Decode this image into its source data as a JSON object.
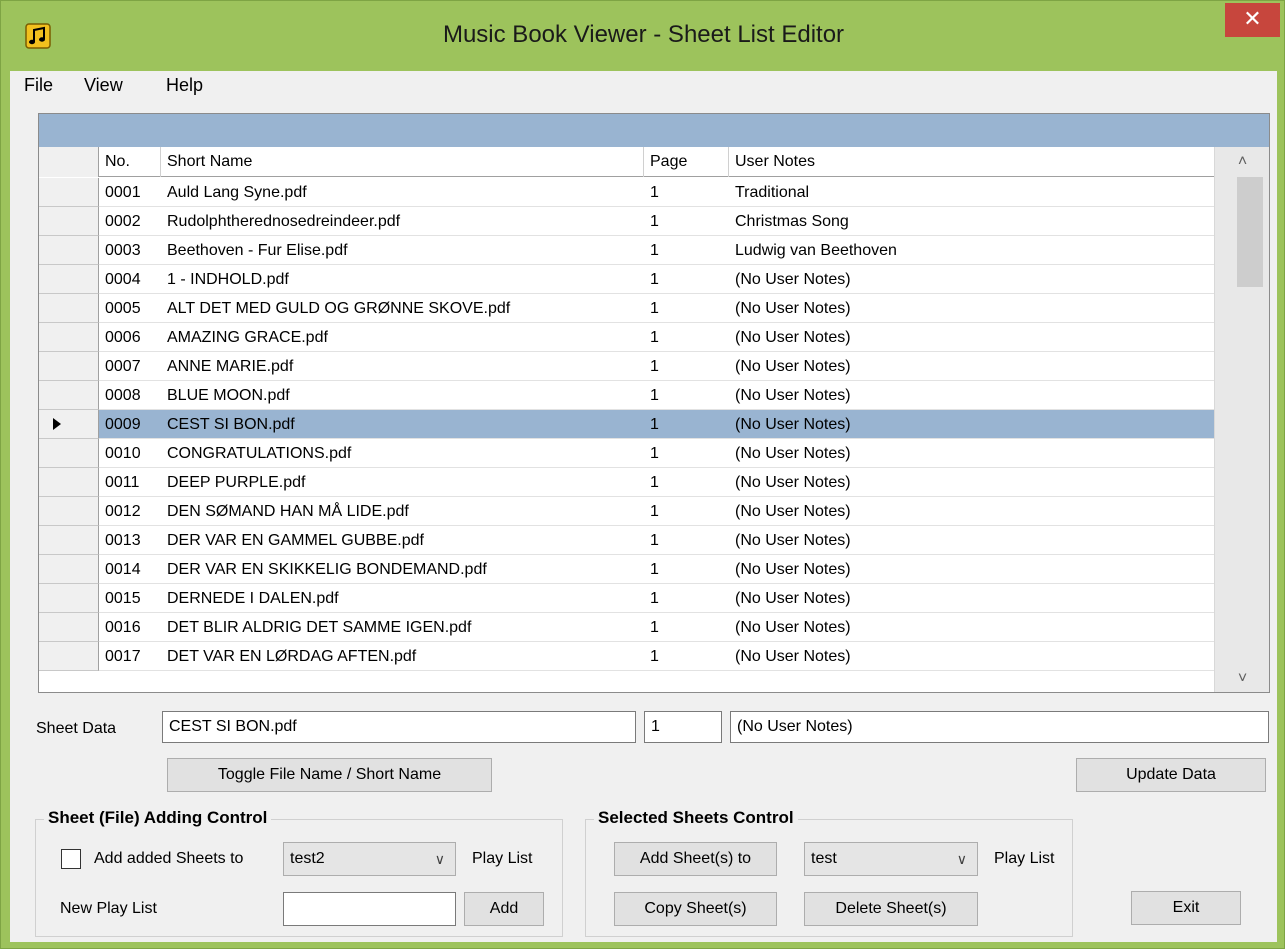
{
  "window": {
    "title": "Music Book Viewer - Sheet List Editor",
    "close_glyph": "✕"
  },
  "menu": [
    "File",
    "View",
    "Help"
  ],
  "grid": {
    "columns": [
      "No.",
      "Short Name",
      "Page",
      "User Notes"
    ],
    "rows": [
      {
        "no": "0001",
        "name": "Auld Lang Syne.pdf",
        "page": "1",
        "notes": "Traditional"
      },
      {
        "no": "0002",
        "name": "Rudolphtherednosedreindeer.pdf",
        "page": "1",
        "notes": "Christmas Song"
      },
      {
        "no": "0003",
        "name": "Beethoven - Fur Elise.pdf",
        "page": "1",
        "notes": "Ludwig van Beethoven"
      },
      {
        "no": "0004",
        "name": "1 - INDHOLD.pdf",
        "page": "1",
        "notes": "(No User Notes)"
      },
      {
        "no": "0005",
        "name": "ALT DET MED GULD OG GRØNNE SKOVE.pdf",
        "page": "1",
        "notes": "(No User Notes)"
      },
      {
        "no": "0006",
        "name": "AMAZING GRACE.pdf",
        "page": "1",
        "notes": "(No User Notes)"
      },
      {
        "no": "0007",
        "name": "ANNE MARIE.pdf",
        "page": "1",
        "notes": "(No User Notes)"
      },
      {
        "no": "0008",
        "name": "BLUE MOON.pdf",
        "page": "1",
        "notes": "(No User Notes)"
      },
      {
        "no": "0009",
        "name": "CEST SI BON.pdf",
        "page": "1",
        "notes": "(No User Notes)"
      },
      {
        "no": "0010",
        "name": "CONGRATULATIONS.pdf",
        "page": "1",
        "notes": "(No User Notes)"
      },
      {
        "no": "0011",
        "name": "DEEP PURPLE.pdf",
        "page": "1",
        "notes": "(No User Notes)"
      },
      {
        "no": "0012",
        "name": "DEN SØMAND HAN MÅ LIDE.pdf",
        "page": "1",
        "notes": "(No User Notes)"
      },
      {
        "no": "0013",
        "name": "DER VAR EN GAMMEL GUBBE.pdf",
        "page": "1",
        "notes": "(No User Notes)"
      },
      {
        "no": "0014",
        "name": "DER VAR EN SKIKKELIG BONDEMAND.pdf",
        "page": "1",
        "notes": "(No User Notes)"
      },
      {
        "no": "0015",
        "name": "DERNEDE I DALEN.pdf",
        "page": "1",
        "notes": "(No User Notes)"
      },
      {
        "no": "0016",
        "name": "DET BLIR ALDRIG DET SAMME IGEN.pdf",
        "page": "1",
        "notes": "(No User Notes)"
      },
      {
        "no": "0017",
        "name": "DET VAR EN LØRDAG AFTEN.pdf",
        "page": "1",
        "notes": "(No User Notes)"
      }
    ],
    "selected_row": "0009",
    "scroll_up": "˄",
    "scroll_down": "˅"
  },
  "sheet_data": {
    "label": "Sheet Data",
    "name_value": "CEST SI BON.pdf",
    "page_value": "1",
    "notes_value": "(No User Notes)"
  },
  "buttons": {
    "toggle": "Toggle File Name / Short Name",
    "update": "Update Data",
    "add_sheets_to": "Add Sheet(s) to",
    "copy": "Copy Sheet(s)",
    "delete": "Delete Sheet(s)",
    "add": "Add",
    "exit": "Exit"
  },
  "adding_control": {
    "title": "Sheet (File) Adding Control",
    "checkbox_label": "Add added Sheets to",
    "checked": false,
    "playlist_value": "test2",
    "play_list_label": "Play List",
    "new_play_list_label": "New Play List",
    "new_play_list_value": ""
  },
  "selected_control": {
    "title": "Selected Sheets Control",
    "playlist_value": "test",
    "play_list_label": "Play List"
  },
  "colors": {
    "frame": "#9dc35c",
    "selection": "#99b4d1",
    "close": "#c7463d"
  }
}
